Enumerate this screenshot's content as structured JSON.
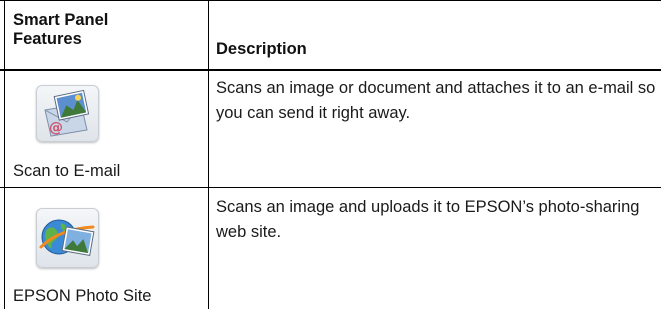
{
  "header": {
    "col1": "Smart Panel Features",
    "col1_line1": "Smart Panel",
    "col1_line2": "Features",
    "col2": "Description"
  },
  "rows": [
    {
      "feature": "Scan to E-mail",
      "icon": "scan-to-email-icon",
      "description": "Scans an image or document and attaches it to an e-mail so you can send it right away."
    },
    {
      "feature": "EPSON Photo Site",
      "icon": "epson-photo-site-icon",
      "description": "Scans an image and uploads it to EPSON’s photo-sharing web site."
    }
  ]
}
